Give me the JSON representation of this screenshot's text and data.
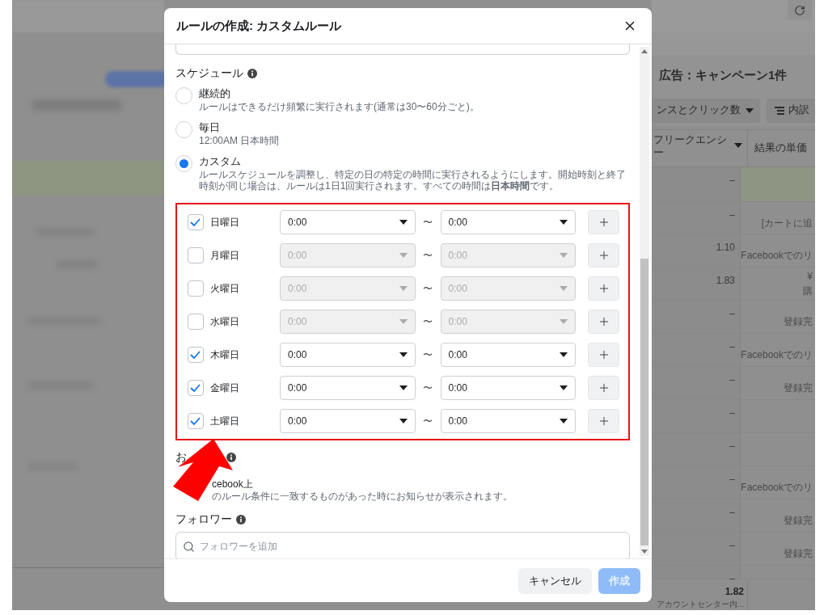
{
  "background_page": {
    "title": "広告：キャンペーン1件",
    "metrics_button": "ンスとクリック数",
    "breakdown_button": "内訳",
    "table": {
      "columns": [
        "フリークエンシー",
        "結果の単価"
      ],
      "rows": [
        {
          "frequency": "–",
          "highlighted": true
        },
        {
          "frequency": "–",
          "highlighted": false,
          "result_cost": "[カートに追"
        },
        {
          "frequency": "1.10",
          "highlighted": false,
          "result_cost": "Facebookでのリ"
        },
        {
          "frequency": "1.83",
          "highlighted": false,
          "result_cost": "¥",
          "result_note": "購"
        },
        {
          "frequency": "–",
          "highlighted": false,
          "result_cost": "登録完"
        },
        {
          "frequency": "–",
          "highlighted": false,
          "result_cost": "Facebookでのリ"
        },
        {
          "frequency": "–",
          "highlighted": false,
          "result_cost": "登録完"
        },
        {
          "frequency": "–",
          "highlighted": false
        },
        {
          "frequency": "–",
          "highlighted": false
        },
        {
          "frequency": "–",
          "highlighted": false,
          "result_cost": "Facebookでのリ"
        },
        {
          "frequency": "–",
          "highlighted": false,
          "result_cost": "登録完"
        },
        {
          "frequency": "–",
          "highlighted": false,
          "result_cost": "登録完"
        },
        {
          "frequency": "–",
          "highlighted": false
        }
      ],
      "footer": {
        "frequency": "1.82",
        "note": "アカウントセンター内..."
      }
    }
  },
  "dialog": {
    "title": "ルールの作成: カスタムルール",
    "schedule": {
      "heading": "スケジュール",
      "options": [
        {
          "label": "継続的",
          "description": "ルールはできるだけ頻繁に実行されます(通常は30〜60分ごと)。",
          "selected": false
        },
        {
          "label": "毎日",
          "description": "12:00AM 日本時間",
          "selected": false
        },
        {
          "label": "カスタム",
          "description": "ルールスケジュールを調整し、特定の日の特定の時間に実行されるようにします。開始時刻と終了時刻が同じ場合は、ルールは1日1回実行されます。すべての時間は**日本時間**です。",
          "selected": true
        }
      ],
      "days": [
        {
          "label": "日曜日",
          "checked": true,
          "start": "0:00",
          "separator": "〜",
          "end": "0:00"
        },
        {
          "label": "月曜日",
          "checked": false,
          "start": "0:00",
          "separator": "〜",
          "end": "0:00"
        },
        {
          "label": "火曜日",
          "checked": false,
          "start": "0:00",
          "separator": "〜",
          "end": "0:00"
        },
        {
          "label": "水曜日",
          "checked": false,
          "start": "0:00",
          "separator": "〜",
          "end": "0:00"
        },
        {
          "label": "木曜日",
          "checked": true,
          "start": "0:00",
          "separator": "〜",
          "end": "0:00"
        },
        {
          "label": "金曜日",
          "checked": true,
          "start": "0:00",
          "separator": "〜",
          "end": "0:00"
        },
        {
          "label": "土曜日",
          "checked": true,
          "start": "0:00",
          "separator": "〜",
          "end": "0:00"
        }
      ]
    },
    "notifications": {
      "heading": "お",
      "label": "cebook上",
      "description": "のルール条件に一致するものがあった時にお知らせが表示されます。"
    },
    "followers": {
      "heading": "フォロワー",
      "search": {
        "placeholder": "フォロワーを追加"
      }
    },
    "buttons": [
      {
        "label": "キャンセル",
        "kind": "secondary",
        "disabled": false
      },
      {
        "label": "作成",
        "kind": "primary",
        "disabled": true
      }
    ]
  }
}
